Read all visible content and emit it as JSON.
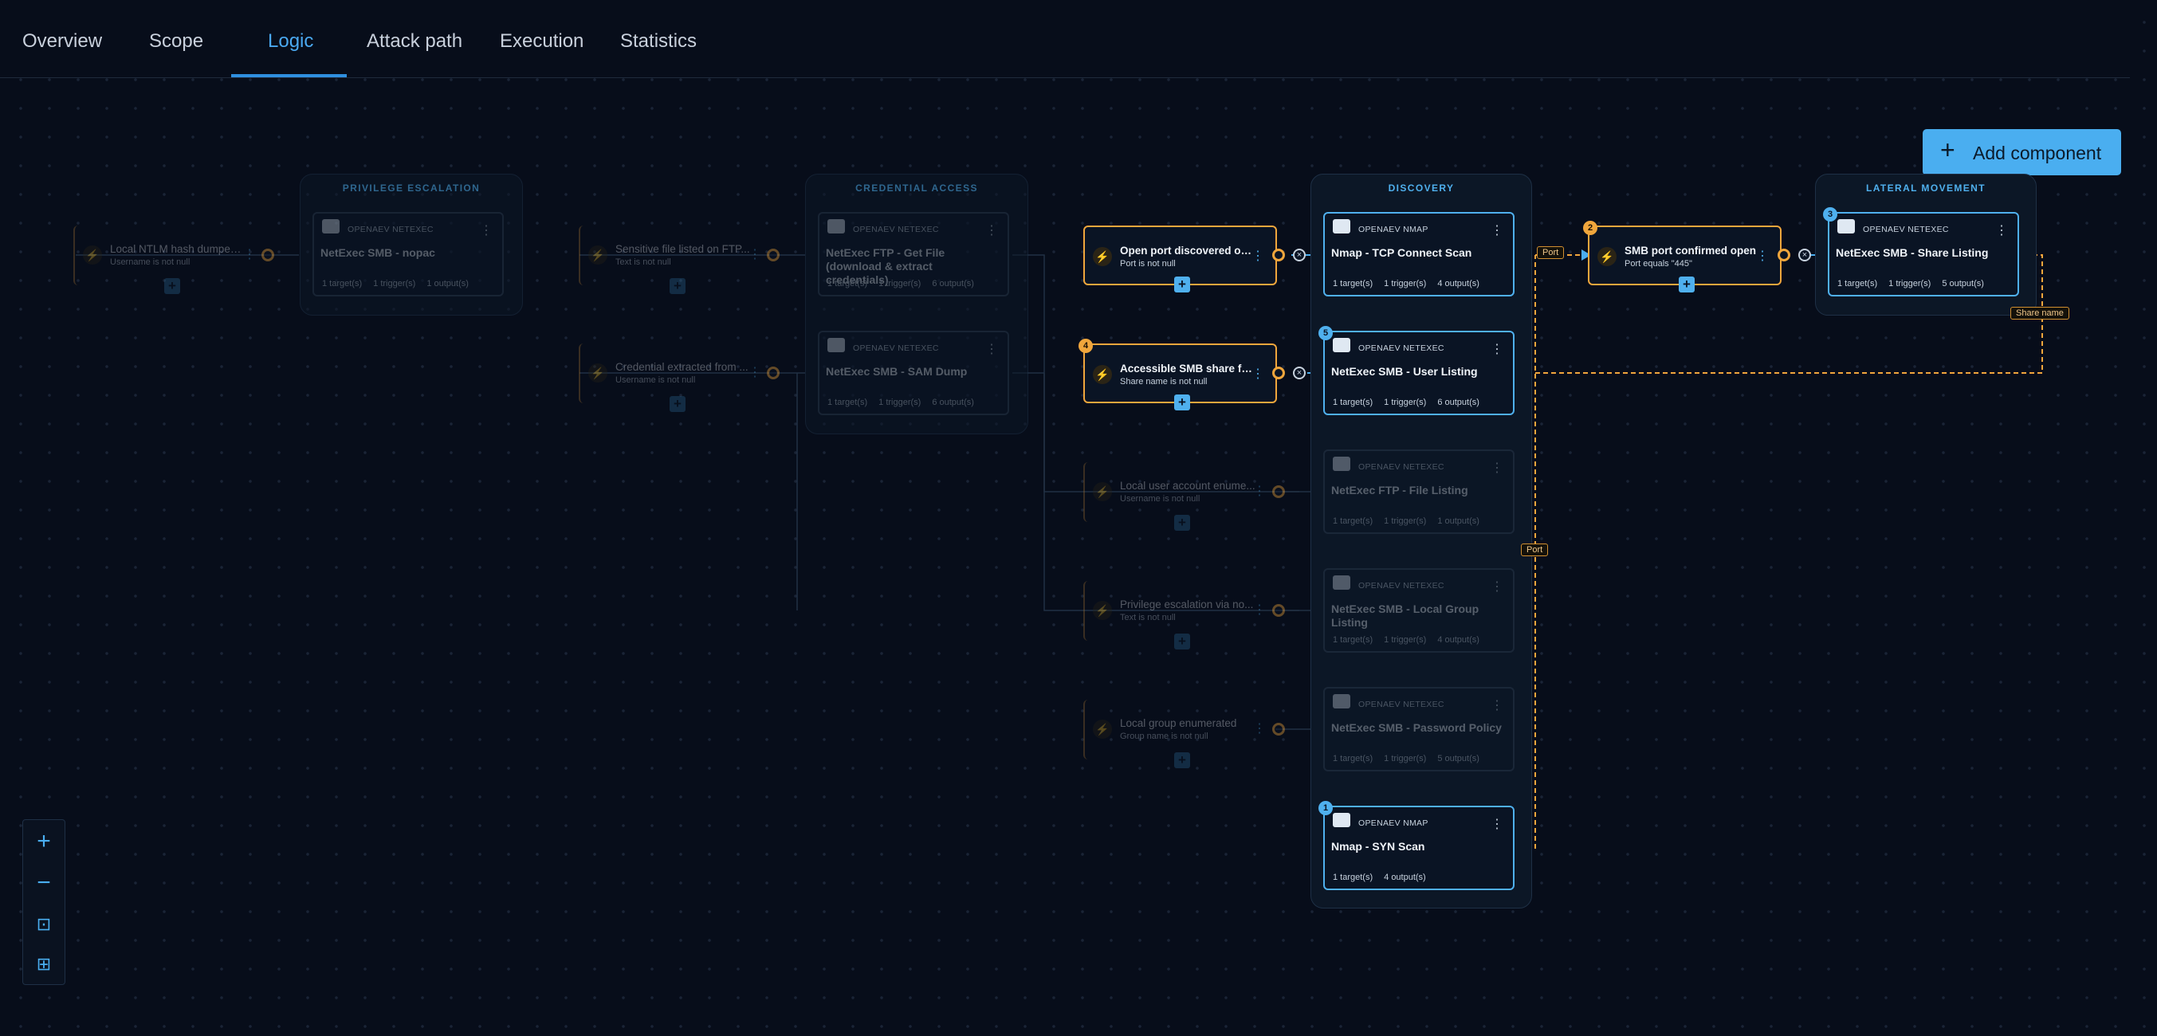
{
  "tabs": [
    {
      "label": "Overview"
    },
    {
      "label": "Scope"
    },
    {
      "label": "Logic",
      "active": true
    },
    {
      "label": "Attack path"
    },
    {
      "label": "Execution"
    },
    {
      "label": "Statistics"
    }
  ],
  "toolbar": {
    "add_component_label": "Add component"
  },
  "columns": {
    "privilege_escalation": "PRIVILEGE ESCALATION",
    "credential_access": "CREDENTIAL ACCESS",
    "discovery": "DISCOVERY",
    "lateral_movement": "LATERAL MOVEMENT"
  },
  "vendors": {
    "nmap": "OPENAEV NMAP",
    "netexec": "OPENAEV NETEXEC"
  },
  "nodes": {
    "nopac": {
      "title": "NetExec SMB - nopac",
      "targets": "1 target(s)",
      "triggers": "1 trigger(s)",
      "outputs": "1 output(s)"
    },
    "ftp_get": {
      "title": "NetExec FTP - Get File (download & extract credentials)",
      "targets": "1 target(s)",
      "triggers": "1 trigger(s)",
      "outputs": "6 output(s)"
    },
    "sam_dump": {
      "title": "NetExec SMB - SAM Dump",
      "targets": "1 target(s)",
      "triggers": "1 trigger(s)",
      "outputs": "6 output(s)"
    },
    "tcp_scan": {
      "title": "Nmap - TCP Connect Scan",
      "targets": "1 target(s)",
      "triggers": "1 trigger(s)",
      "outputs": "4 output(s)"
    },
    "user_listing": {
      "title": "NetExec SMB - User Listing",
      "badge": "5",
      "targets": "1 target(s)",
      "triggers": "1 trigger(s)",
      "outputs": "6 output(s)"
    },
    "ftp_listing": {
      "title": "NetExec FTP - File Listing",
      "targets": "1 target(s)",
      "triggers": "1 trigger(s)",
      "outputs": "1 output(s)"
    },
    "local_group": {
      "title": "NetExec SMB - Local Group Listing",
      "targets": "1 target(s)",
      "triggers": "1 trigger(s)",
      "outputs": "4 output(s)"
    },
    "password_policy": {
      "title": "NetExec SMB - Password Policy",
      "targets": "1 target(s)",
      "triggers": "1 trigger(s)",
      "outputs": "5 output(s)"
    },
    "syn_scan": {
      "title": "Nmap - SYN Scan",
      "badge": "1",
      "targets": "1 target(s)",
      "outputs": "4 output(s)"
    },
    "share_listing": {
      "title": "NetExec SMB - Share Listing",
      "badge": "3",
      "targets": "1 target(s)",
      "triggers": "1 trigger(s)",
      "outputs": "5 output(s)"
    }
  },
  "conditions": {
    "ntlm": {
      "title": "Local NTLM hash dumped ...",
      "subtitle": "Username is not null"
    },
    "ftp_file": {
      "title": "Sensitive file listed on FTP...",
      "subtitle": "Text is not null"
    },
    "cred": {
      "title": "Credential extracted from ...",
      "subtitle": "Username is not null"
    },
    "open_port": {
      "title": "Open port discovered on p...",
      "subtitle": "Port is not null"
    },
    "smb_share": {
      "title": "Accessible SMB share found",
      "subtitle": "Share name is not null",
      "badge": "4"
    },
    "smb_port": {
      "title": "SMB port confirmed open",
      "subtitle": "Port equals \"445\"",
      "badge": "2"
    },
    "local_user": {
      "title": "Local user account enume...",
      "subtitle": "Username is not null"
    },
    "privesc": {
      "title": "Privilege escalation via no...",
      "subtitle": "Text is not null"
    },
    "group": {
      "title": "Local group enumerated",
      "subtitle": "Group name is not null"
    }
  },
  "edge_labels": {
    "port_1": "Port",
    "port_2": "Port",
    "share_name": "Share name"
  },
  "icons": [
    "plus-icon",
    "minus-icon",
    "fit-view-icon",
    "layout-icon",
    "bolt-icon",
    "kebab-icon",
    "target-icon",
    "output-icon"
  ],
  "colors": {
    "accent": "#4aaef0",
    "condition": "#f0a63c",
    "background": "#070d1a"
  }
}
